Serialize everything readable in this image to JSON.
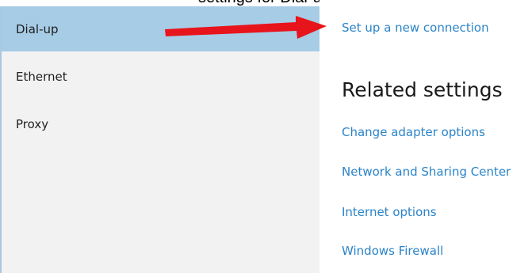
{
  "caption": "settings for Dial-up, Ethernet and Proxy",
  "nav": {
    "items": [
      {
        "label": "Dial-up",
        "selected": true
      },
      {
        "label": "Ethernet",
        "selected": false
      },
      {
        "label": "Proxy",
        "selected": false
      }
    ]
  },
  "content": {
    "setup_link": "Set up a new connection",
    "related_title": "Related settings",
    "related_links": [
      "Change adapter options",
      "Network and Sharing Center",
      "Internet options",
      "Windows Firewall"
    ]
  },
  "colors": {
    "selected_bg": "#a6cce6",
    "nav_bg": "#f2f2f2",
    "link": "#2b84c8",
    "annotation_arrow": "#e8141b"
  }
}
